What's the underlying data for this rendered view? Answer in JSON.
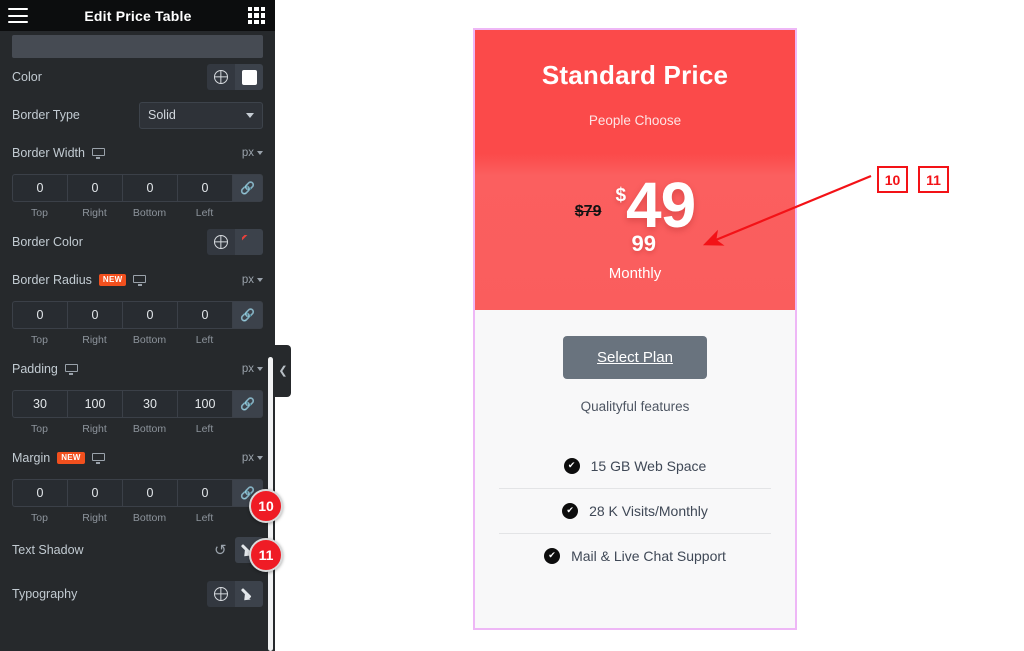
{
  "panel": {
    "title": "Edit Price Table",
    "menu_icon": "hamburger-icon",
    "apps_icon": "grid-icon",
    "rows": {
      "color": {
        "label": "Color",
        "globe_icon": "globe-icon",
        "swatch_value": "#ffffff"
      },
      "border_type": {
        "label": "Border Type",
        "value": "Solid"
      },
      "border_width": {
        "label": "Border Width",
        "unit": "px",
        "responsive_icon": "monitor-icon",
        "values": [
          "0",
          "0",
          "0",
          "0"
        ],
        "sides": [
          "Top",
          "Right",
          "Bottom",
          "Left"
        ],
        "link_icon": "link-icon"
      },
      "border_color": {
        "label": "Border Color",
        "globe_icon": "globe-icon",
        "swatch_value": "none"
      },
      "border_radius": {
        "label": "Border Radius",
        "badge": "NEW",
        "unit": "px",
        "responsive_icon": "monitor-icon",
        "values": [
          "0",
          "0",
          "0",
          "0"
        ],
        "sides": [
          "Top",
          "Right",
          "Bottom",
          "Left"
        ],
        "link_icon": "link-icon"
      },
      "padding": {
        "label": "Padding",
        "unit": "px",
        "responsive_icon": "monitor-icon",
        "values": [
          "30",
          "100",
          "30",
          "100"
        ],
        "sides": [
          "Top",
          "Right",
          "Bottom",
          "Left"
        ],
        "link_icon": "link-icon"
      },
      "margin": {
        "label": "Margin",
        "badge": "NEW",
        "unit": "px",
        "responsive_icon": "monitor-icon",
        "values": [
          "0",
          "0",
          "0",
          "0"
        ],
        "sides": [
          "Top",
          "Right",
          "Bottom",
          "Left"
        ],
        "link_icon": "link-icon"
      },
      "text_shadow": {
        "label": "Text Shadow",
        "reset_icon": "reset-icon",
        "edit_icon": "pencil-icon"
      },
      "typography": {
        "label": "Typography",
        "globe_icon": "globe-icon",
        "edit_icon": "pencil-icon"
      }
    },
    "collapse_handle_icon": "chevron-left-icon"
  },
  "steps": [
    {
      "number": "10"
    },
    {
      "number": "11"
    }
  ],
  "annotations": {
    "boxes": [
      {
        "label": "10"
      },
      {
        "label": "11"
      }
    ],
    "arrow_color": "#f31217"
  },
  "card": {
    "title": "Standard Price",
    "subtitle": "People Choose",
    "old_price": "$79",
    "currency": "$",
    "price_integer": "49",
    "price_fraction": "99",
    "period": "Monthly",
    "cta_label": "Select Plan",
    "features_note": "Qualityful features",
    "features": [
      {
        "icon": "check-circle-icon",
        "label": "15 GB Web Space"
      },
      {
        "icon": "check-circle-icon",
        "label": "28 K Visits/Monthly"
      },
      {
        "icon": "check-circle-icon",
        "label": "Mail & Live Chat Support"
      }
    ],
    "colors": {
      "header_bg": "#fb4a4a",
      "price_bg": "#fa5d5d",
      "border": "#eeb7f6",
      "body_bg": "#f8f8f9",
      "cta_bg": "#69737e"
    }
  }
}
